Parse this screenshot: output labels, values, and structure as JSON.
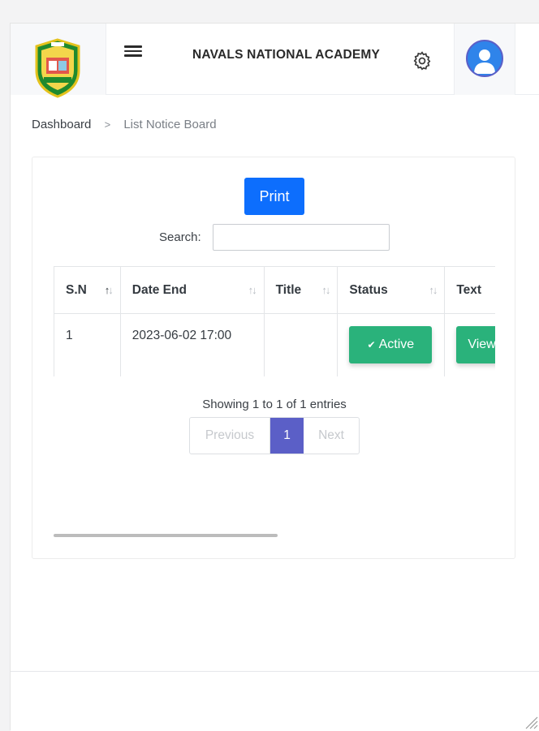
{
  "header": {
    "school_name": "NAVALS NATIONAL ACADEMY"
  },
  "breadcrumb": {
    "home": "Dashboard",
    "separator": ">",
    "current": "List Notice Board"
  },
  "toolbar": {
    "print_label": "Print",
    "search_label": "Search:",
    "search_value": "",
    "search_placeholder": ""
  },
  "table": {
    "columns": [
      "S.N",
      "Date End",
      "Title",
      "Status",
      "Text"
    ],
    "sort_glyph": "↑↓",
    "rows": [
      {
        "sn": "1",
        "date_end": "2023-06-02 17:00",
        "title": "",
        "status_label": "Active",
        "status_check": "✔",
        "text_button": "View"
      }
    ]
  },
  "pagination": {
    "info": "Showing 1 to 1 of 1 entries",
    "previous": "Previous",
    "current_page": "1",
    "next": "Next"
  },
  "colors": {
    "primary": "#0d6efd",
    "success": "#2ab27b",
    "page_active": "#5b5fc7"
  },
  "icons": {
    "menu": "hamburger-icon",
    "settings": "gear-icon",
    "user": "user-avatar-icon",
    "logo": "school-crest-logo"
  }
}
